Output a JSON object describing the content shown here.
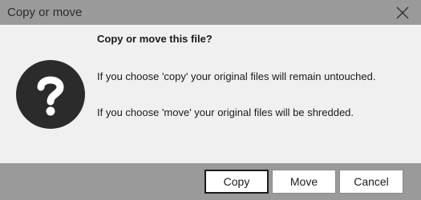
{
  "window": {
    "title": "Copy or move",
    "close_icon": "close-icon"
  },
  "message": {
    "icon": "question-icon",
    "heading": "Copy or move this file?",
    "line1": "If you choose 'copy' your original files will remain untouched.",
    "line2": "If you choose 'move' your original files will be shredded."
  },
  "buttons": {
    "copy": "Copy",
    "move": "Move",
    "cancel": "Cancel"
  },
  "colors": {
    "chrome": "#9a9a9a",
    "body": "#f0f0f0",
    "icon": "#2b2b2b"
  }
}
